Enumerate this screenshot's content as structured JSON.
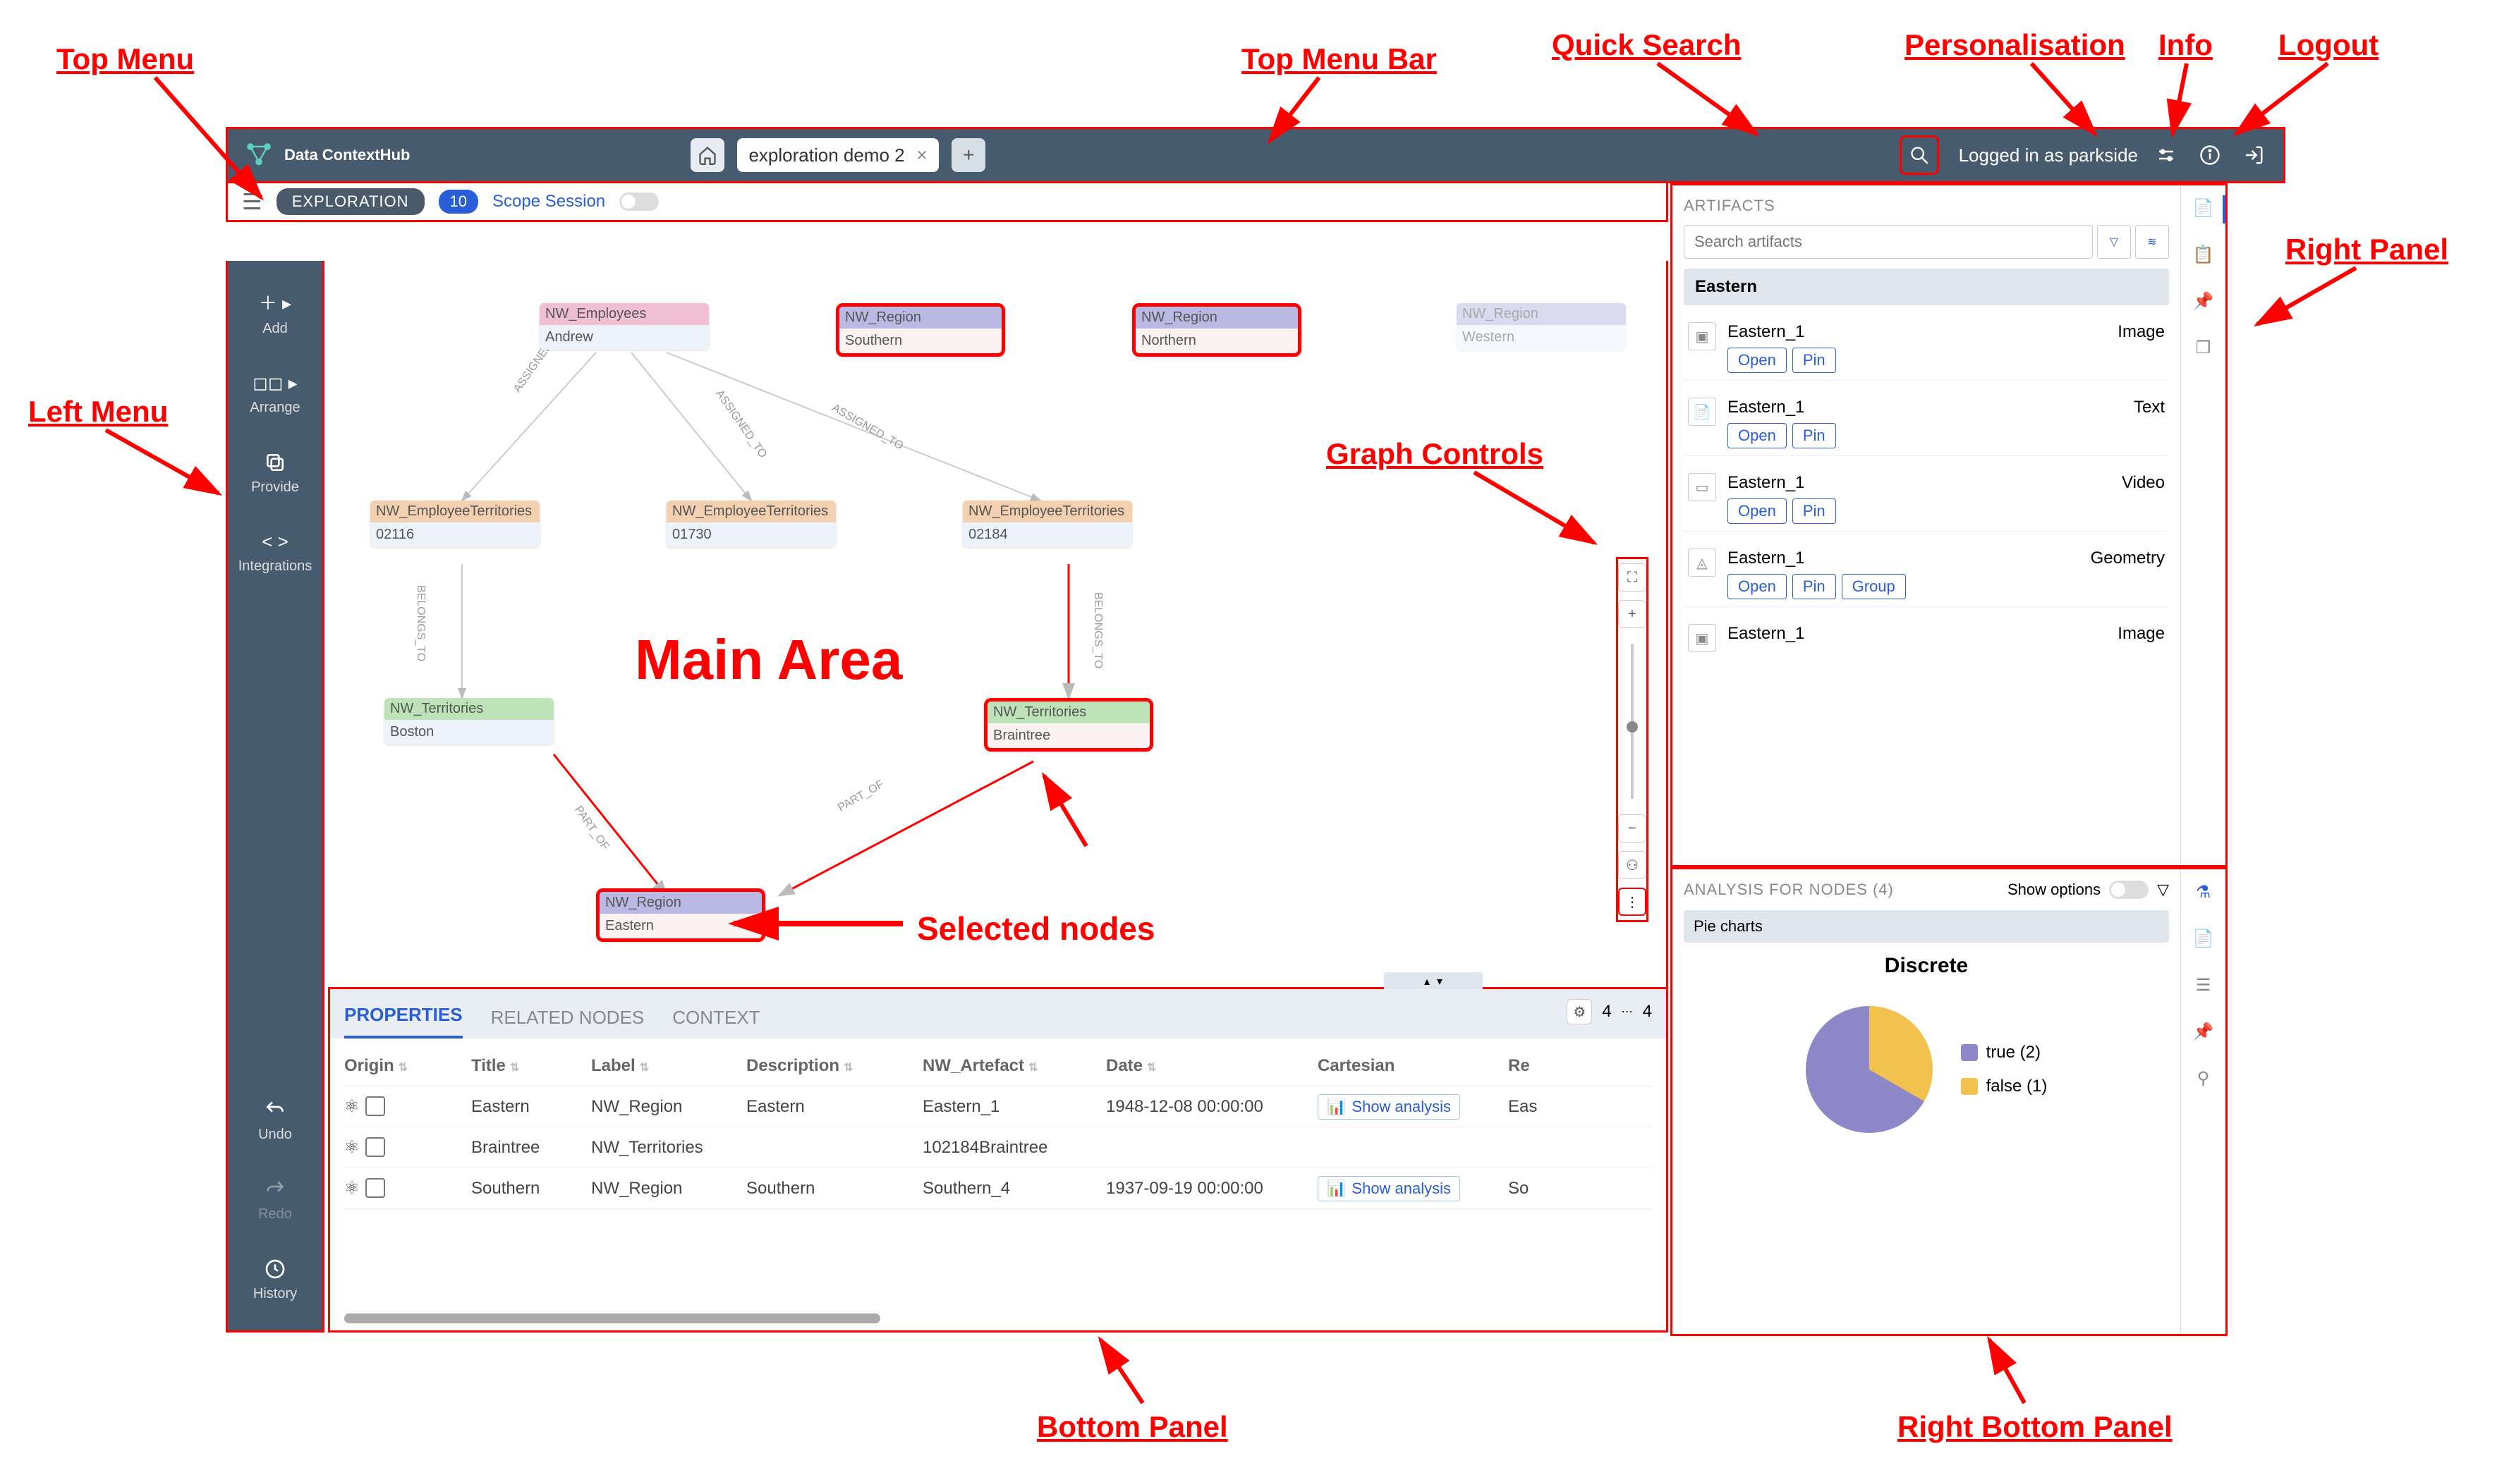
{
  "annotations": {
    "top_menu": "Top Menu",
    "top_menu_bar": "Top Menu  Bar",
    "quick_search": "Quick Search",
    "personalisation": "Personalisation",
    "info": "Info",
    "logout": "Logout",
    "left_menu": "Left Menu",
    "right_panel": "Right Panel",
    "main_area": "Main Area",
    "graph_controls": "Graph Controls",
    "selected_nodes": "Selected nodes",
    "bottom_panel": "Bottom Panel",
    "right_bottom_panel": "Right Bottom Panel"
  },
  "topbar": {
    "brand": "Data ContextHub",
    "tab_label": "exploration demo 2",
    "logged_in": "Logged in as parkside"
  },
  "subbar": {
    "mode": "EXPLORATION",
    "count": "10",
    "scope": "Scope Session"
  },
  "left_menu": {
    "add": "Add",
    "arrange": "Arrange",
    "provide": "Provide",
    "integrations": "Integrations",
    "undo": "Undo",
    "redo": "Redo",
    "history": "History"
  },
  "graph_nodes": {
    "emp": {
      "type": "NW_Employees",
      "value": "Andrew"
    },
    "reg_south": {
      "type": "NW_Region",
      "value": "Southern"
    },
    "reg_north": {
      "type": "NW_Region",
      "value": "Northern"
    },
    "reg_west": {
      "type": "NW_Region",
      "value": "Western"
    },
    "et1": {
      "type": "NW_EmployeeTerritories",
      "value": "02116"
    },
    "et2": {
      "type": "NW_EmployeeTerritories",
      "value": "01730"
    },
    "et3": {
      "type": "NW_EmployeeTerritories",
      "value": "02184"
    },
    "ter1": {
      "type": "NW_Territories",
      "value": "Boston"
    },
    "ter2": {
      "type": "NW_Territories",
      "value": "Braintree"
    },
    "reg_east": {
      "type": "NW_Region",
      "value": "Eastern"
    }
  },
  "edges": {
    "assigned_to": "ASSIGNED_TO",
    "belongs_to": "BELONGS_TO",
    "part_of": "PART_OF"
  },
  "bottom": {
    "tab_properties": "PROPERTIES",
    "tab_related": "RELATED NODES",
    "tab_context": "CONTEXT",
    "count_left": "4",
    "count_right": "4",
    "headers": {
      "origin": "Origin",
      "title": "Title",
      "label": "Label",
      "description": "Description",
      "artefact": "NW_Artefact",
      "date": "Date",
      "cartesian": "Cartesian",
      "re": "Re"
    },
    "rows": [
      {
        "title": "Eastern",
        "label": "NW_Region",
        "description": "Eastern",
        "artefact": "Eastern_1",
        "date": "1948-12-08 00:00:00",
        "analysis": "Show analysis",
        "re": "Eas"
      },
      {
        "title": "Braintree",
        "label": "NW_Territories",
        "description": "",
        "artefact": "102184Braintree",
        "date": "",
        "analysis": "",
        "re": ""
      },
      {
        "title": "Southern",
        "label": "NW_Region",
        "description": "Southern",
        "artefact": "Southern_4",
        "date": "1937-09-19 00:00:00",
        "analysis": "Show analysis",
        "re": "So"
      }
    ]
  },
  "artifacts": {
    "title": "ARTIFACTS",
    "search_placeholder": "Search artifacts",
    "group": "Eastern",
    "open": "Open",
    "pin": "Pin",
    "group_btn": "Group",
    "items": [
      {
        "name": "Eastern_1",
        "type": "Image",
        "icon": "image"
      },
      {
        "name": "Eastern_1",
        "type": "Text",
        "icon": "text"
      },
      {
        "name": "Eastern_1",
        "type": "Video",
        "icon": "video"
      },
      {
        "name": "Eastern_1",
        "type": "Geometry",
        "icon": "geometry",
        "group": true
      },
      {
        "name": "Eastern_1",
        "type": "Image",
        "icon": "image"
      }
    ]
  },
  "analysis": {
    "title": "ANALYSIS FOR NODES (4)",
    "show_options": "Show options",
    "section": "Pie charts",
    "chart_title": "Discrete",
    "legend_true": "true (2)",
    "legend_false": "false (1)"
  },
  "chart_data": {
    "type": "pie",
    "title": "Discrete",
    "series": [
      {
        "name": "true",
        "value": 2,
        "color": "#8e88c9"
      },
      {
        "name": "false",
        "value": 1,
        "color": "#f2c14e"
      }
    ]
  }
}
